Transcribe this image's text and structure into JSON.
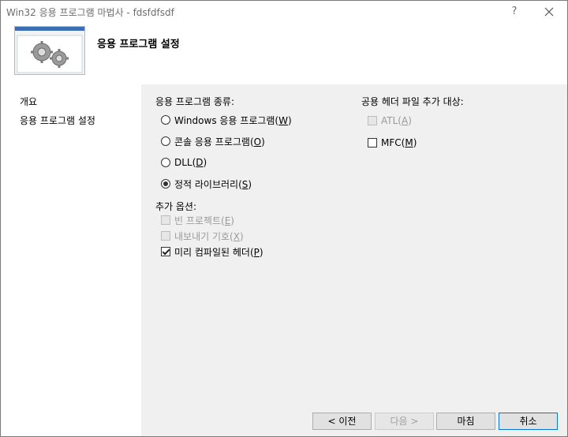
{
  "window": {
    "title": "Win32 응용 프로그램 마법사 - fdsfdfsdf",
    "help_label": "?",
    "header_title": "응용 프로그램 설정"
  },
  "sidebar": {
    "items": [
      {
        "label": "개요"
      },
      {
        "label": "응용 프로그램 설정"
      }
    ]
  },
  "app_type": {
    "label": "응용 프로그램 종류:",
    "options": [
      {
        "text": "Windows 응용 프로그램(",
        "key": "W",
        "end": ")",
        "selected": false
      },
      {
        "text": "콘솔 응용 프로그램(",
        "key": "O",
        "end": ")",
        "selected": false
      },
      {
        "text": "DLL(",
        "key": "D",
        "end": ")",
        "selected": false
      },
      {
        "text": "정적 라이브러리(",
        "key": "S",
        "end": ")",
        "selected": true
      }
    ]
  },
  "extra_options": {
    "label": "추가 옵션:",
    "options": [
      {
        "text": "빈 프로젝트(",
        "key": "E",
        "end": ")",
        "checked": false,
        "enabled": false
      },
      {
        "text": "내보내기 기호(",
        "key": "X",
        "end": ")",
        "checked": false,
        "enabled": false
      },
      {
        "text": "미리 컴파일된 헤더(",
        "key": "P",
        "end": ")",
        "checked": true,
        "enabled": true
      }
    ]
  },
  "common_headers": {
    "label": "공용 헤더 파일 추가 대상:",
    "options": [
      {
        "text": "ATL(",
        "key": "A",
        "end": ")",
        "checked": false,
        "enabled": false
      },
      {
        "text": "MFC(",
        "key": "M",
        "end": ")",
        "checked": false,
        "enabled": true
      }
    ]
  },
  "buttons": {
    "prev": "< 이전",
    "next": "다음 >",
    "finish": "마침",
    "cancel": "취소"
  }
}
